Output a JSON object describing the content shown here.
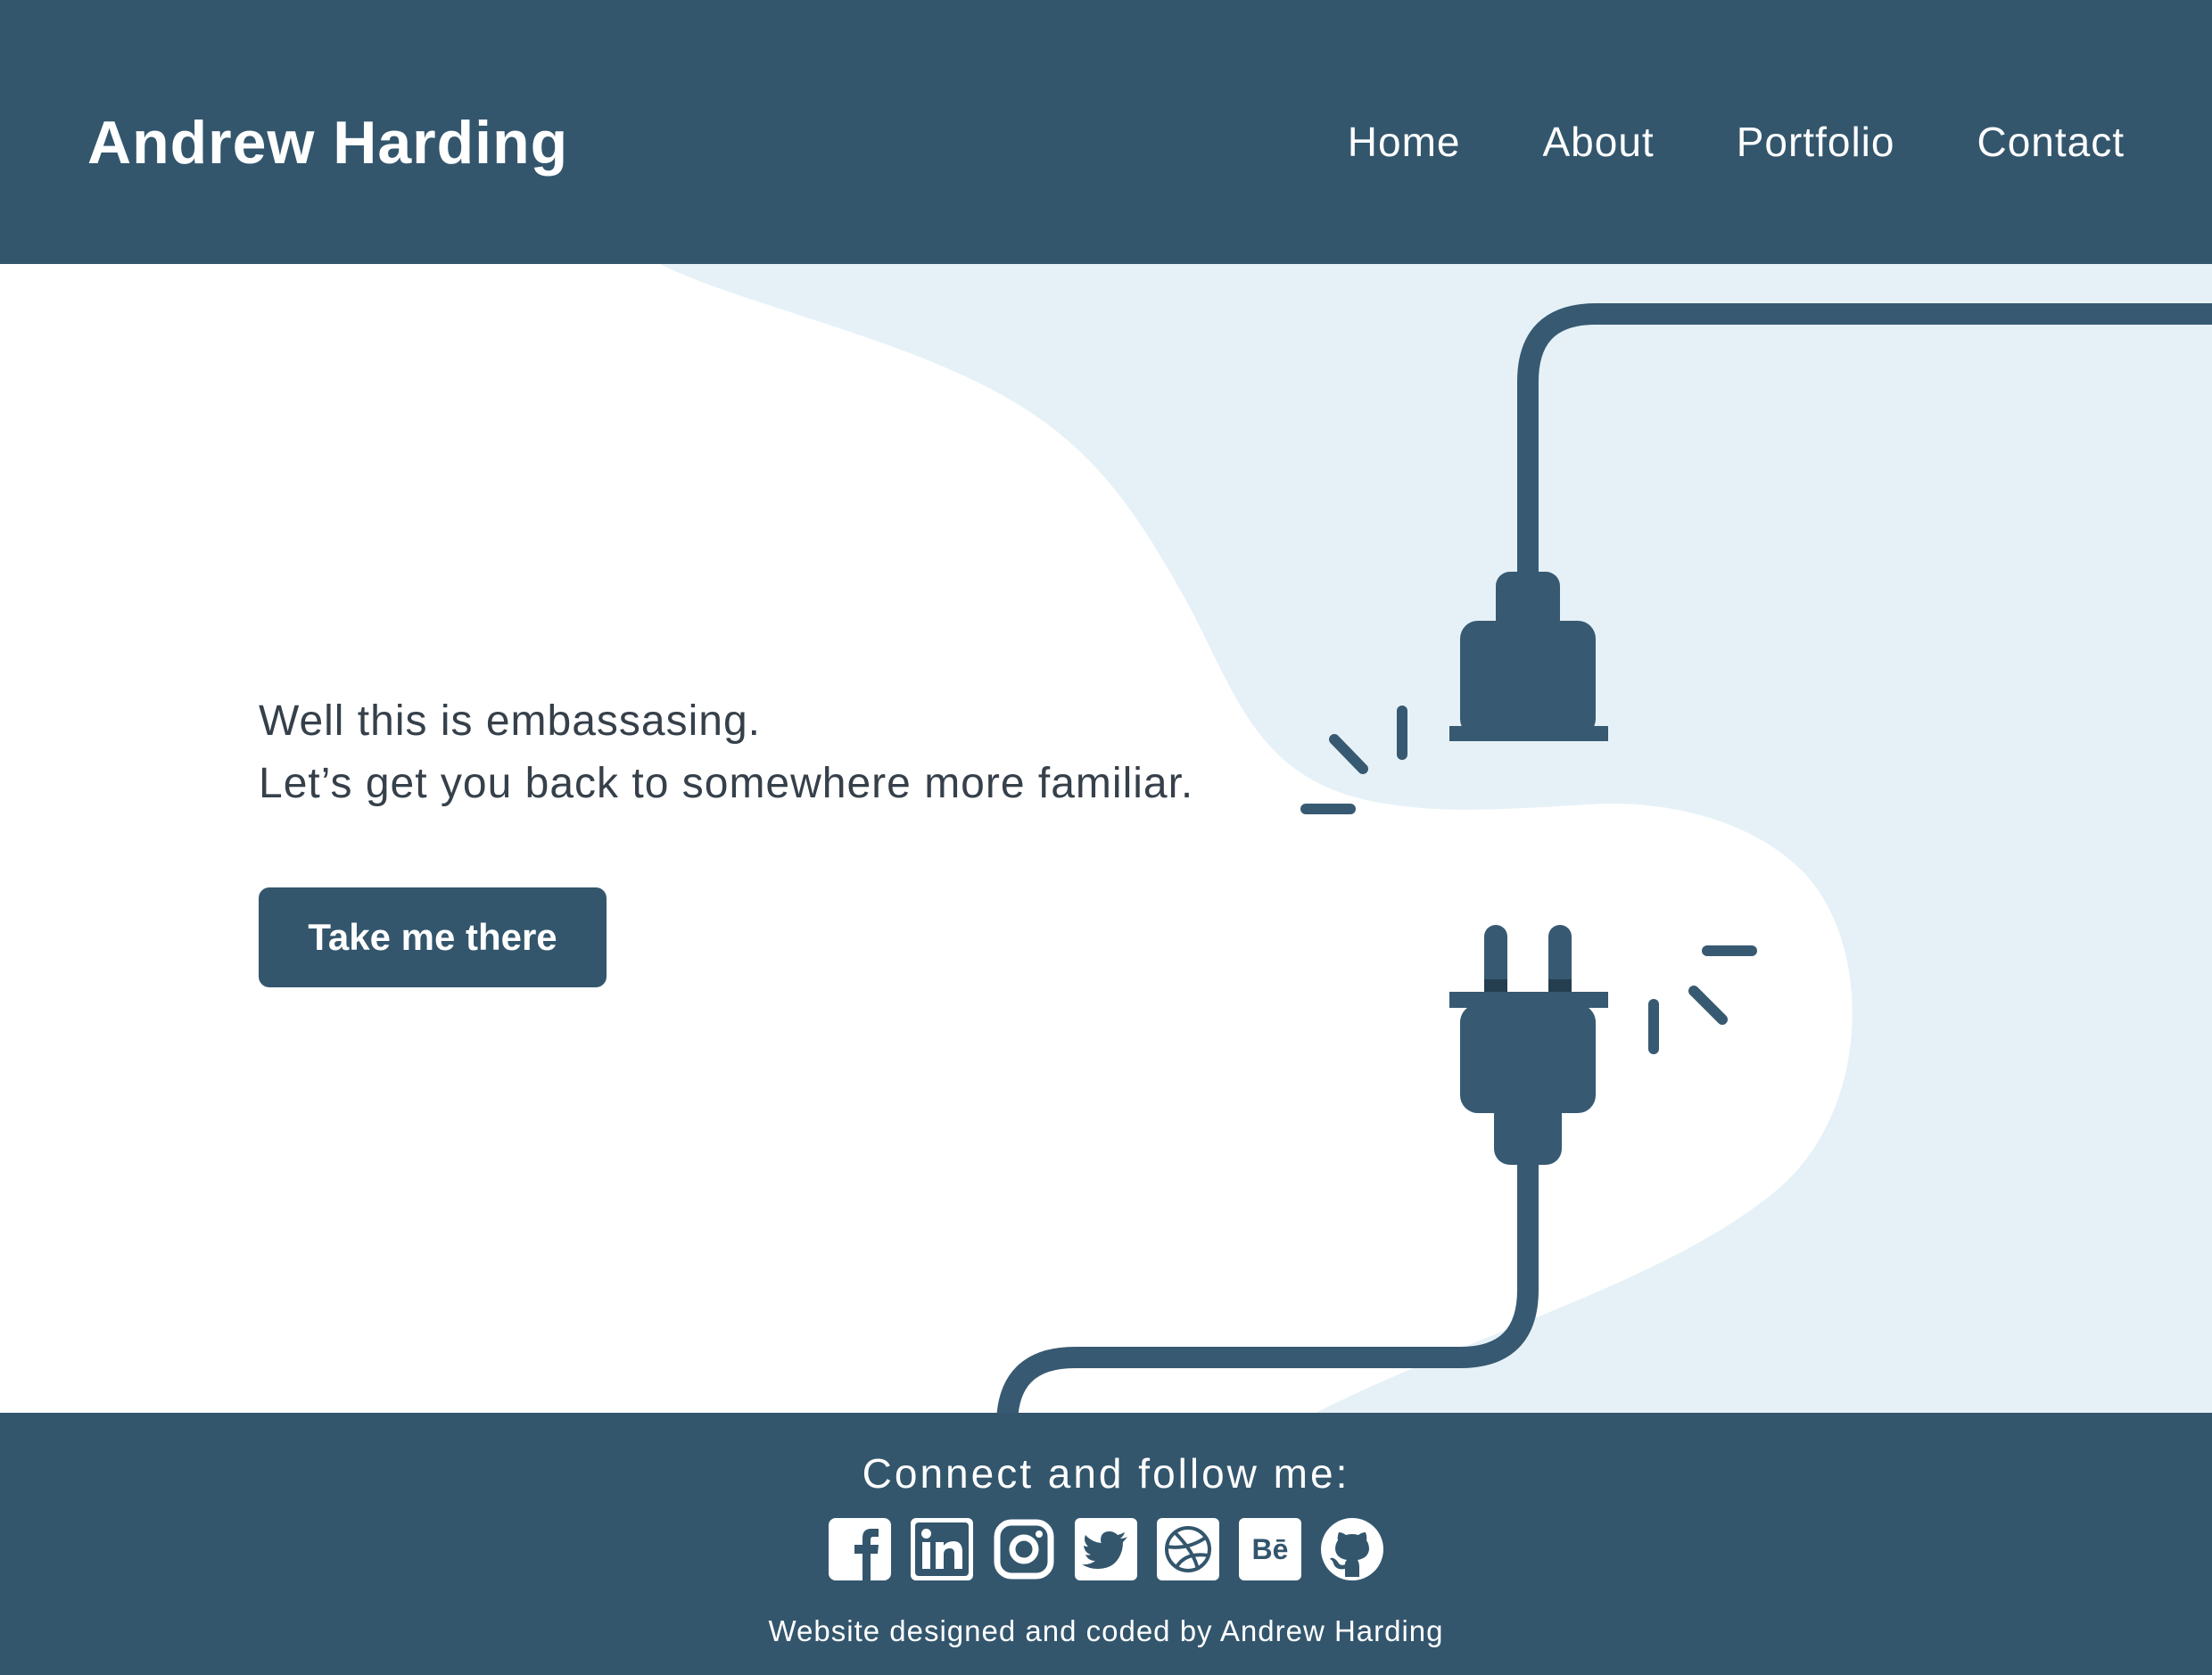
{
  "header": {
    "brand": "Andrew Harding",
    "nav": [
      "Home",
      "About",
      "Portfolio",
      "Contact"
    ]
  },
  "main": {
    "message_line_1": "Well this is embassasing.",
    "message_line_2": "Let’s get you back to somewhere more familiar.",
    "cta_label": "Take me there",
    "illustration": "unplugged-plug-and-socket"
  },
  "footer": {
    "heading": "Connect and follow me:",
    "social": [
      "facebook-icon",
      "linkedin-icon",
      "instagram-icon",
      "twitter-icon",
      "dribbble-icon",
      "behance-icon",
      "github-icon"
    ],
    "credit": "Website designed and coded by Andrew Harding"
  },
  "colors": {
    "primary": "#33566d",
    "illustration_dark": "#375a72",
    "blob": "#e6f1f7",
    "text": "#36404a",
    "background": "#ffffff"
  }
}
